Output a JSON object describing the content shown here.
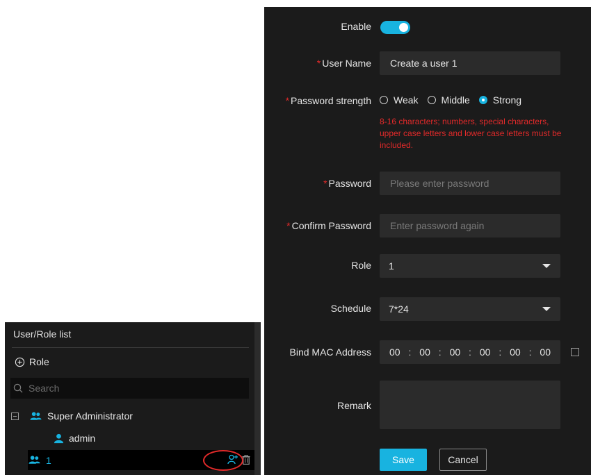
{
  "left_panel": {
    "title": "User/Role list",
    "add_role_label": "Role",
    "search_placeholder": "Search",
    "tree": {
      "group_label": "Super Administrator",
      "user_label": "admin",
      "role_label": "1"
    }
  },
  "form": {
    "enable_label": "Enable",
    "enable_on": true,
    "username_label": "User Name",
    "username_value": "Create a user 1",
    "strength_label": "Password strength",
    "strength_options": [
      "Weak",
      "Middle",
      "Strong"
    ],
    "strength_selected": "Strong",
    "password_hint": "8-16 characters; numbers, special characters, upper case letters and lower case letters must be included.",
    "password_label": "Password",
    "password_placeholder": "Please enter password",
    "confirm_label": "Confirm Password",
    "confirm_placeholder": "Enter password again",
    "role_label": "Role",
    "role_value": "1",
    "schedule_label": "Schedule",
    "schedule_value": "7*24",
    "mac_label": "Bind MAC Address",
    "mac_octets": [
      "00",
      "00",
      "00",
      "00",
      "00",
      "00"
    ],
    "mac_separator": ":",
    "remark_label": "Remark",
    "save_label": "Save",
    "cancel_label": "Cancel",
    "required_mark": "*"
  },
  "colors": {
    "accent": "#18b3e0",
    "error": "#e32a2a",
    "panel_bg": "#1b1b1b",
    "field_bg": "#2b2b2b"
  },
  "icons": {
    "add_role": "plus-circle-icon",
    "search": "search-icon",
    "group": "users-icon",
    "user": "user-icon",
    "add_user": "add-user-icon",
    "delete": "trash-icon",
    "dropdown": "caret-down-icon"
  }
}
